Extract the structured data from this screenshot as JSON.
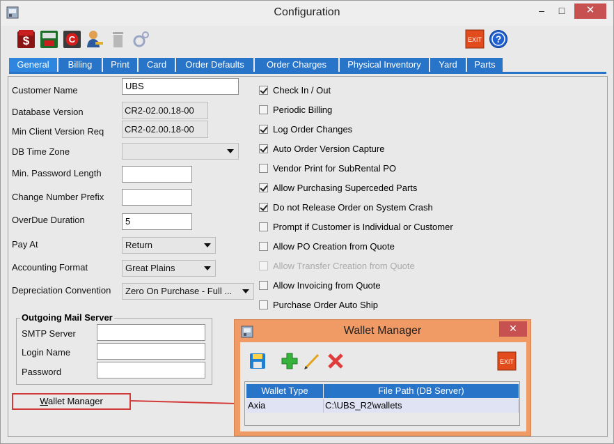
{
  "window": {
    "title": "Configuration",
    "minimize": "–",
    "maximize": "□",
    "close": "✕"
  },
  "toolbar": {
    "icons": [
      "pal-dollar-icon",
      "bill-icon",
      "c-record-icon",
      "user-key-icon",
      "trash-disabled-icon",
      "gear-disabled-icon"
    ],
    "exit_label": "EXIT",
    "help_label": "?"
  },
  "tabs": [
    "General",
    "Billing",
    "Print",
    "Card",
    "Order Defaults",
    "Order  Charges",
    "Physical Inventory",
    "Yard",
    "Parts"
  ],
  "form": {
    "customer_name_label": "Customer Name",
    "customer_name_value": "UBS",
    "db_version_label": "Database Version",
    "db_version_value": "CR2-02.00.18-00",
    "min_client_label": "Min Client Version Req",
    "min_client_value": "CR2-02.00.18-00",
    "db_timezone_label": "DB Time Zone",
    "db_timezone_value": "",
    "min_password_label": "Min. Password Length",
    "min_password_value": "",
    "change_prefix_label": "Change Number Prefix",
    "change_prefix_value": "",
    "overdue_label": "OverDue Duration",
    "overdue_value": "5",
    "pay_at_label": "Pay At",
    "pay_at_value": "Return",
    "accounting_label": "Accounting Format",
    "accounting_value": "Great Plains",
    "depreciation_label": "Depreciation Convention",
    "depreciation_value": "Zero On Purchase - Full ..."
  },
  "checkboxes": [
    {
      "label": "Check In / Out",
      "checked": true,
      "disabled": false
    },
    {
      "label": "Periodic Billing",
      "checked": false,
      "disabled": false
    },
    {
      "label": "Log Order Changes",
      "checked": true,
      "disabled": false
    },
    {
      "label": "Auto Order Version Capture",
      "checked": true,
      "disabled": false
    },
    {
      "label": "Vendor Print for SubRental PO",
      "checked": false,
      "disabled": false
    },
    {
      "label": "Allow Purchasing Superceded Parts",
      "checked": true,
      "disabled": false
    },
    {
      "label": "Do not Release Order on System Crash",
      "checked": true,
      "disabled": false
    },
    {
      "label": "Prompt if Customer is Individual or Customer",
      "checked": false,
      "disabled": false
    },
    {
      "label": "Allow PO Creation from Quote",
      "checked": false,
      "disabled": false
    },
    {
      "label": "Allow Transfer Creation from Quote",
      "checked": false,
      "disabled": true
    },
    {
      "label": "Allow Invoicing from Quote",
      "checked": false,
      "disabled": false
    },
    {
      "label": "Purchase Order Auto Ship",
      "checked": false,
      "disabled": false
    }
  ],
  "mail": {
    "legend": "Outgoing Mail Server",
    "smtp_label": "SMTP Server",
    "smtp_value": "",
    "login_label": "Login Name",
    "login_value": "",
    "password_label": "Password",
    "password_value": ""
  },
  "wallet_link": {
    "underlined": "W",
    "rest": "allet Manager"
  },
  "wallet_dialog": {
    "title": "Wallet Manager",
    "close": "✕",
    "exit_label": "EXIT",
    "columns": [
      "Wallet Type",
      "File Path (DB Server)"
    ],
    "rows": [
      {
        "wallet_type": "Axia",
        "file_path": "C:\\UBS_R2\\wallets"
      }
    ]
  },
  "colors": {
    "tab_blue": "#2874c8",
    "dialog_orange": "#f09a66",
    "highlight_red": "#d23a3a",
    "close_red": "#c75050"
  }
}
